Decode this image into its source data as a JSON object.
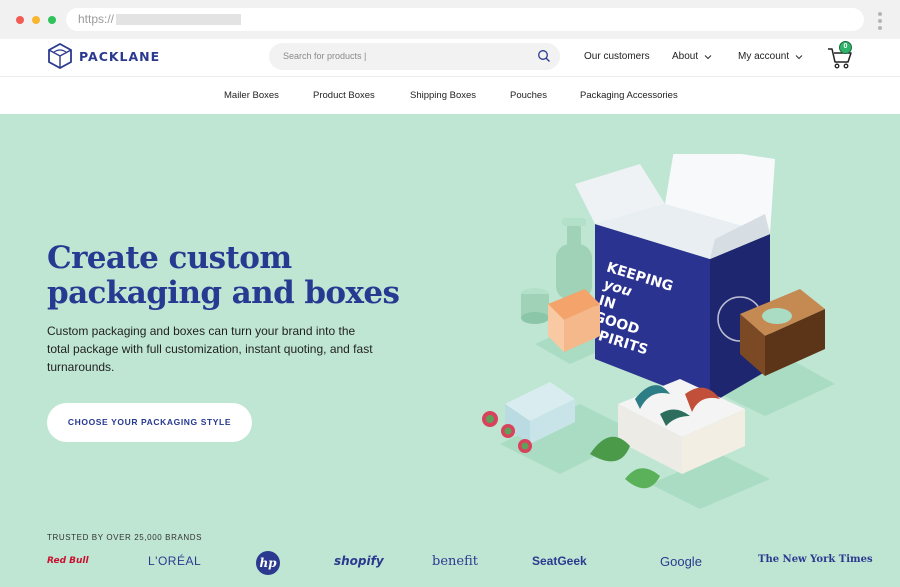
{
  "browser": {
    "url_prefix": "https://"
  },
  "header": {
    "logo_text": "PACKLANE",
    "search_placeholder": "Search for products |",
    "nav": {
      "customers": "Our customers",
      "about": "About",
      "account": "My account"
    },
    "cart_count": "0"
  },
  "categories": [
    "Mailer Boxes",
    "Product Boxes",
    "Shipping Boxes",
    "Pouches",
    "Packaging Accessories"
  ],
  "hero": {
    "headline_line1": "Create custom",
    "headline_line2": "packaging and boxes",
    "subtext": "Custom packaging and boxes can turn your brand into the total package with full customization, instant quoting, and fast turnarounds.",
    "cta_label": "CHOOSE YOUR PACKAGING STYLE",
    "trusted_label": "TRUSTED BY OVER 25,000 BRANDS"
  },
  "brands": [
    "Red Bull",
    "L'ORÉAL",
    "hp",
    "shopify",
    "benefit",
    "SeatGeek",
    "Google",
    "The New York Times"
  ],
  "box_text": [
    "KEEPING",
    "you",
    "IN",
    "GOOD",
    "SPIRITS"
  ],
  "colors": {
    "brand_blue": "#263a91",
    "hero_bg": "#bfe6d3",
    "cart_badge": "#2fb36b"
  }
}
